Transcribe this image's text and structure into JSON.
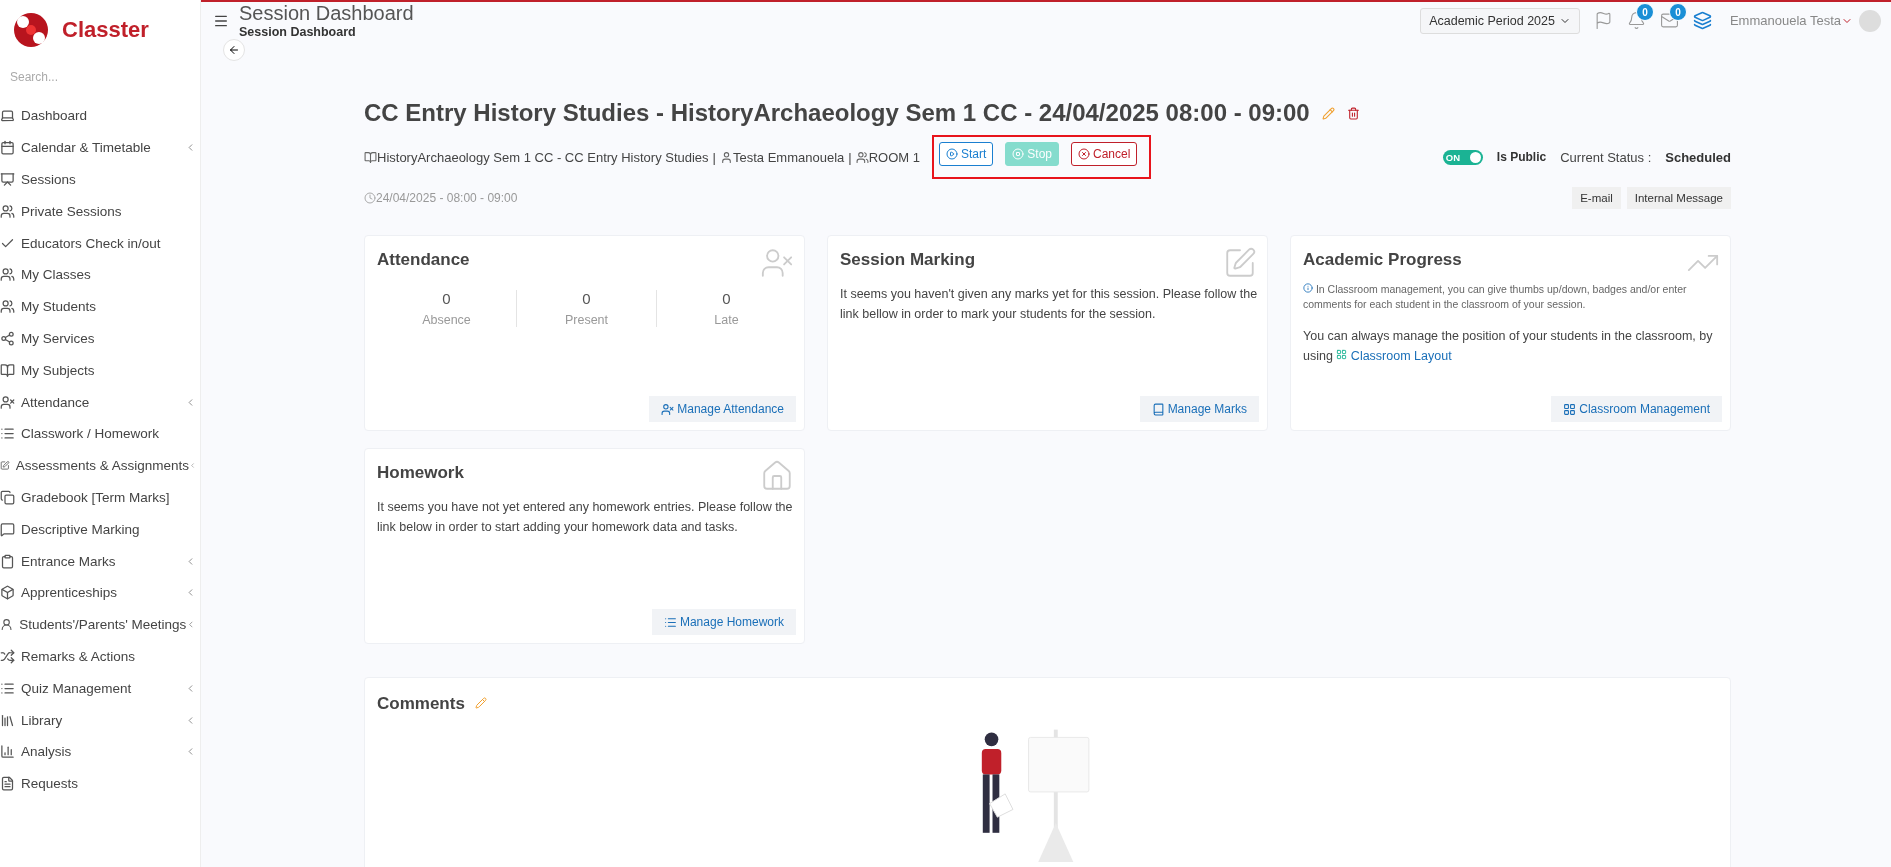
{
  "brand": {
    "name": "Classter"
  },
  "sidebar": {
    "search": {
      "placeholder": "Search..."
    },
    "items": [
      {
        "label": "Dashboard",
        "submenu": false
      },
      {
        "label": "Calendar & Timetable",
        "submenu": true
      },
      {
        "label": "Sessions",
        "submenu": false
      },
      {
        "label": "Private Sessions",
        "submenu": false
      },
      {
        "label": "Educators Check in/out",
        "submenu": false
      },
      {
        "label": "My Classes",
        "submenu": false
      },
      {
        "label": "My Students",
        "submenu": false
      },
      {
        "label": "My Services",
        "submenu": false
      },
      {
        "label": "My Subjects",
        "submenu": false
      },
      {
        "label": "Attendance",
        "submenu": true
      },
      {
        "label": "Classwork / Homework",
        "submenu": false
      },
      {
        "label": "Assessments & Assignments",
        "submenu": true
      },
      {
        "label": "Gradebook [Term Marks]",
        "submenu": false
      },
      {
        "label": "Descriptive Marking",
        "submenu": false
      },
      {
        "label": "Entrance Marks",
        "submenu": true
      },
      {
        "label": "Apprenticeships",
        "submenu": true
      },
      {
        "label": "Students'/Parents' Meetings",
        "submenu": true
      },
      {
        "label": "Remarks & Actions",
        "submenu": false
      },
      {
        "label": "Quiz Management",
        "submenu": true
      },
      {
        "label": "Library",
        "submenu": true
      },
      {
        "label": "Analysis",
        "submenu": true
      },
      {
        "label": "Requests",
        "submenu": false
      }
    ]
  },
  "header": {
    "title": "Session Dashboard",
    "breadcrumb": "Session Dashboard",
    "period": "Academic Period 2025",
    "notifications": "0",
    "messages": "0",
    "user": "Emmanouela Testa"
  },
  "session": {
    "title": "CC Entry History Studies - HistoryArchaeology Sem 1 CC - 24/04/2025 08:00 - 09:00",
    "course": "HistoryArchaeology Sem 1 CC - CC Entry History Studies",
    "separator": "|",
    "educator": "Testa Emmanouela",
    "room": "ROOM 1",
    "datetime": "24/04/2025 - 08:00 - 09:00",
    "actions_highlighted": true,
    "actions": [
      {
        "kind": "start",
        "label": "Start",
        "disabled": false
      },
      {
        "kind": "stop",
        "label": "Stop",
        "disabled": true
      },
      {
        "kind": "cancel",
        "label": "Cancel",
        "disabled": false
      }
    ],
    "public": {
      "on": true,
      "switch_label": "ON",
      "label": "Is Public"
    },
    "status": {
      "label": "Current Status :",
      "value": "Scheduled"
    },
    "contact_buttons": [
      "E-mail",
      "Internal Message"
    ]
  },
  "cards": [
    {
      "kind": "attendance",
      "title": "Attendance",
      "stats": [
        {
          "value": "0",
          "label": "Absence"
        },
        {
          "value": "0",
          "label": "Present"
        },
        {
          "value": "0",
          "label": "Late"
        }
      ],
      "button": "Manage Attendance"
    },
    {
      "kind": "marking",
      "title": "Session Marking",
      "text": "It seems you haven't given any marks yet for this session. Please follow the link bellow in order to mark your students for the session.",
      "button": "Manage Marks"
    },
    {
      "kind": "progress",
      "title": "Academic Progress",
      "note": "In Classroom management, you can give thumbs up/down, badges and/or enter comments for each student in the classroom of your session.",
      "text": "You can always manage the position of your students in the classroom, by using",
      "link": "Classroom Layout",
      "button": "Classroom Management"
    },
    {
      "kind": "homework",
      "title": "Homework",
      "text": "It seems you have not yet entered any homework entries. Please follow the link below in order to start adding your homework data and tasks.",
      "button": "Manage Homework"
    }
  ],
  "comments": {
    "title": "Comments"
  }
}
